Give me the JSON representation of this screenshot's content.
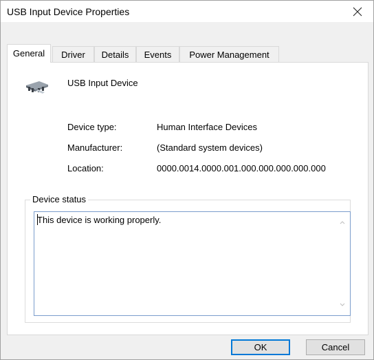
{
  "window": {
    "title": "USB Input Device Properties",
    "close_icon": "close-icon"
  },
  "tabs": [
    {
      "label": "General",
      "active": true
    },
    {
      "label": "Driver",
      "active": false
    },
    {
      "label": "Details",
      "active": false
    },
    {
      "label": "Events",
      "active": false
    },
    {
      "label": "Power Management",
      "active": false
    }
  ],
  "device": {
    "icon": "usb-device-icon",
    "name": "USB Input Device"
  },
  "properties": [
    {
      "label": "Device type:",
      "value": "Human Interface Devices"
    },
    {
      "label": "Manufacturer:",
      "value": "(Standard system devices)"
    },
    {
      "label": "Location:",
      "value": "0000.0014.0000.001.000.000.000.000.000"
    }
  ],
  "status": {
    "group_label": "Device status",
    "text": "This device is working properly."
  },
  "buttons": {
    "ok": "OK",
    "cancel": "Cancel"
  },
  "colors": {
    "focus_border": "#7a9ccc",
    "default_button_border": "#0078d7"
  }
}
